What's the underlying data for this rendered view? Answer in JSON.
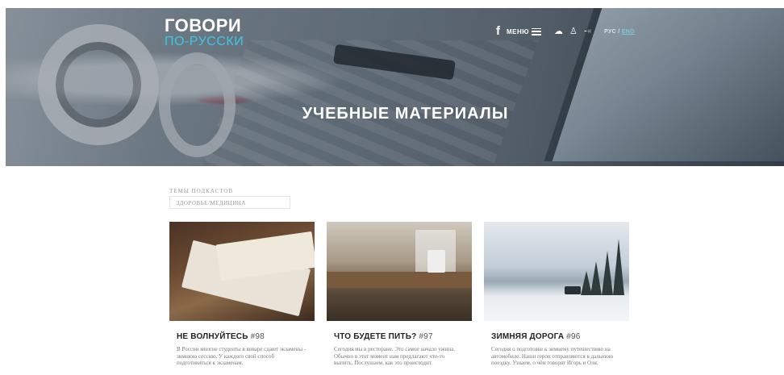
{
  "header": {
    "logo_main": "ГОВОРИ",
    "logo_sub": "ПО-РУССКИ",
    "facebook_icon": "f",
    "menu_label": "МЕНЮ",
    "lang_current": "РУС",
    "lang_separator": "/",
    "lang_alt": "ENG"
  },
  "hero": {
    "title": "УЧЕБНЫЕ МАТЕРИАЛЫ"
  },
  "filter": {
    "label": "ТЕМЫ ПОДКАСТОВ",
    "value": "ЗДОРОВЬЕ/МЕДИЦИНА"
  },
  "cards": [
    {
      "title": "НЕ ВОЛНУЙТЕСЬ",
      "number": "#98",
      "text": "В России многие студенты в январе сдают экзамены - зимнюю сессию. У каждого свой способ подготовиться к экзаменам."
    },
    {
      "title": "ЧТО БУДЕТЕ ПИТЬ?",
      "number": "#97",
      "text": "Сегодня мы в ресторане. Это самое начало ужина. Обычно в этот момент нам предлагают что-то выпить. Послушаем, как это происходит."
    },
    {
      "title": "ЗИМНЯЯ ДОРОГА",
      "number": "#96",
      "text": "Сегодня о подготовке к зимнему путешествию на автомобиле. Наши герои отправляются в дальнюю поездку. Узнаем, о чём говорят Игорь и Оля."
    }
  ],
  "colors": {
    "accent": "#3bc8e6",
    "hero_text": "#ffffff"
  }
}
